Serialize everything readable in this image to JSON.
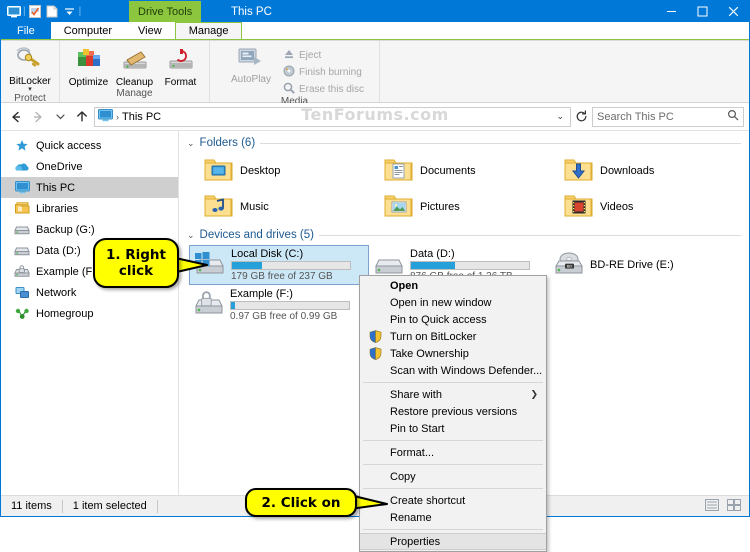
{
  "window": {
    "title": "This PC",
    "contextual_tab_header": "Drive Tools",
    "quick_access_icons": [
      "this-pc-icon",
      "properties-icon",
      "new-folder-icon",
      "customize-dropdown-icon"
    ],
    "caption_buttons": [
      "minimize",
      "maximize",
      "close"
    ]
  },
  "ribbon": {
    "tabs": [
      {
        "label": "File",
        "state": "file"
      },
      {
        "label": "Computer",
        "state": "normal"
      },
      {
        "label": "View",
        "state": "normal"
      },
      {
        "label": "Manage",
        "state": "active"
      }
    ],
    "groups": [
      {
        "label": "Protect",
        "items": [
          {
            "label": "BitLocker",
            "icon": "bitlocker-icon",
            "has_dropdown": true,
            "disabled": false
          }
        ]
      },
      {
        "label": "Manage",
        "items": [
          {
            "label": "Optimize",
            "icon": "optimize-icon",
            "disabled": false
          },
          {
            "label": "Cleanup",
            "icon": "cleanup-icon",
            "disabled": false
          },
          {
            "label": "Format",
            "icon": "format-icon",
            "disabled": false
          }
        ]
      },
      {
        "label": "Media",
        "items": [
          {
            "label": "AutoPlay",
            "icon": "autoplay-icon",
            "disabled": true
          },
          {
            "label": "Eject",
            "icon": "eject-icon",
            "disabled": true
          },
          {
            "label": "Finish burning",
            "icon": "finish-burning-icon",
            "disabled": true
          },
          {
            "label": "Erase this disc",
            "icon": "erase-disc-icon",
            "disabled": true
          }
        ]
      }
    ]
  },
  "address_bar": {
    "back_enabled": true,
    "forward_enabled": false,
    "recent_dropdown": "chevron-down-icon",
    "up_enabled": true,
    "breadcrumb_icon": "this-pc-icon",
    "breadcrumb": "This PC",
    "refresh_icon": "refresh-icon",
    "search_placeholder": "Search This PC",
    "watermark": "TenForums.com"
  },
  "sidebar": {
    "items": [
      {
        "label": "Quick access",
        "icon": "star-icon",
        "selected": false
      },
      {
        "label": "OneDrive",
        "icon": "onedrive-icon",
        "selected": false
      },
      {
        "label": "This PC",
        "icon": "this-pc-icon",
        "selected": true
      },
      {
        "label": "Libraries",
        "icon": "libraries-icon",
        "selected": false
      },
      {
        "label": "Backup (G:)",
        "icon": "drive-icon",
        "selected": false
      },
      {
        "label": "Data (D:)",
        "icon": "drive-icon",
        "selected": false
      },
      {
        "label": "Example (F:)",
        "icon": "locked-drive-icon",
        "selected": false
      },
      {
        "label": "Network",
        "icon": "network-icon",
        "selected": false
      },
      {
        "label": "Homegroup",
        "icon": "homegroup-icon",
        "selected": false
      }
    ]
  },
  "content": {
    "folders_section": {
      "title": "Folders (6)",
      "expanded": true,
      "items": [
        {
          "label": "Desktop",
          "icon": "folder-desktop-icon"
        },
        {
          "label": "Documents",
          "icon": "folder-documents-icon"
        },
        {
          "label": "Downloads",
          "icon": "folder-downloads-icon"
        },
        {
          "label": "Music",
          "icon": "folder-music-icon"
        },
        {
          "label": "Pictures",
          "icon": "folder-pictures-icon"
        },
        {
          "label": "Videos",
          "icon": "folder-videos-icon"
        }
      ]
    },
    "drives_section": {
      "title": "Devices and drives (5)",
      "expanded": true,
      "items": [
        {
          "name": "Local Disk (C:)",
          "free_text": "179 GB free of 237 GB",
          "used_percent": 25,
          "icon": "windows-drive-icon",
          "selected": true,
          "has_bar": true
        },
        {
          "name": "Data (D:)",
          "free_text": "876 GB free of 1.36 TB",
          "used_percent": 37,
          "icon": "drive-icon",
          "selected": false,
          "has_bar": true
        },
        {
          "name": "BD-RE Drive (E:)",
          "free_text": "",
          "used_percent": 0,
          "icon": "bd-re-drive-icon",
          "selected": false,
          "has_bar": false
        },
        {
          "name": "Example (F:)",
          "free_text": "0.97 GB free of 0.99 GB",
          "used_percent": 3,
          "icon": "locked-drive-icon",
          "selected": false,
          "has_bar": true
        }
      ]
    }
  },
  "context_menu": {
    "items": [
      {
        "label": "Open",
        "bold": true,
        "shield": false,
        "submenu": false,
        "highlighted": false,
        "separator_after": false
      },
      {
        "label": "Open in new window",
        "bold": false,
        "shield": false,
        "submenu": false,
        "highlighted": false,
        "separator_after": false
      },
      {
        "label": "Pin to Quick access",
        "bold": false,
        "shield": false,
        "submenu": false,
        "highlighted": false,
        "separator_after": false
      },
      {
        "label": "Turn on BitLocker",
        "bold": false,
        "shield": true,
        "submenu": false,
        "highlighted": false,
        "separator_after": false
      },
      {
        "label": "Take Ownership",
        "bold": false,
        "shield": true,
        "submenu": false,
        "highlighted": false,
        "separator_after": false
      },
      {
        "label": "Scan with Windows Defender...",
        "bold": false,
        "shield": false,
        "submenu": false,
        "highlighted": false,
        "separator_after": true
      },
      {
        "label": "Share with",
        "bold": false,
        "shield": false,
        "submenu": true,
        "highlighted": false,
        "separator_after": false
      },
      {
        "label": "Restore previous versions",
        "bold": false,
        "shield": false,
        "submenu": false,
        "highlighted": false,
        "separator_after": false
      },
      {
        "label": "Pin to Start",
        "bold": false,
        "shield": false,
        "submenu": false,
        "highlighted": false,
        "separator_after": true
      },
      {
        "label": "Format...",
        "bold": false,
        "shield": false,
        "submenu": false,
        "highlighted": false,
        "separator_after": true
      },
      {
        "label": "Copy",
        "bold": false,
        "shield": false,
        "submenu": false,
        "highlighted": false,
        "separator_after": true
      },
      {
        "label": "Create shortcut",
        "bold": false,
        "shield": false,
        "submenu": false,
        "highlighted": false,
        "separator_after": false
      },
      {
        "label": "Rename",
        "bold": false,
        "shield": false,
        "submenu": false,
        "highlighted": false,
        "separator_after": true
      },
      {
        "label": "Properties",
        "bold": false,
        "shield": false,
        "submenu": false,
        "highlighted": true,
        "separator_after": false
      }
    ]
  },
  "callouts": [
    {
      "id": "callout-right-click",
      "text": "1. Right click"
    },
    {
      "id": "callout-click-on",
      "text": "2. Click on"
    }
  ],
  "status_bar": {
    "item_count": "11 items",
    "selection": "1 item selected",
    "view_icons": [
      "details-view-icon",
      "large-icons-view-icon"
    ]
  },
  "colors": {
    "accent": "#0078d7",
    "contextual_tab": "#8cc63f",
    "selection_fill": "#cce8f7",
    "selection_border": "#7da2ce",
    "progress_blue": "#26a0da",
    "callout_yellow": "#ffff00",
    "section_header": "#1d5a8f"
  }
}
